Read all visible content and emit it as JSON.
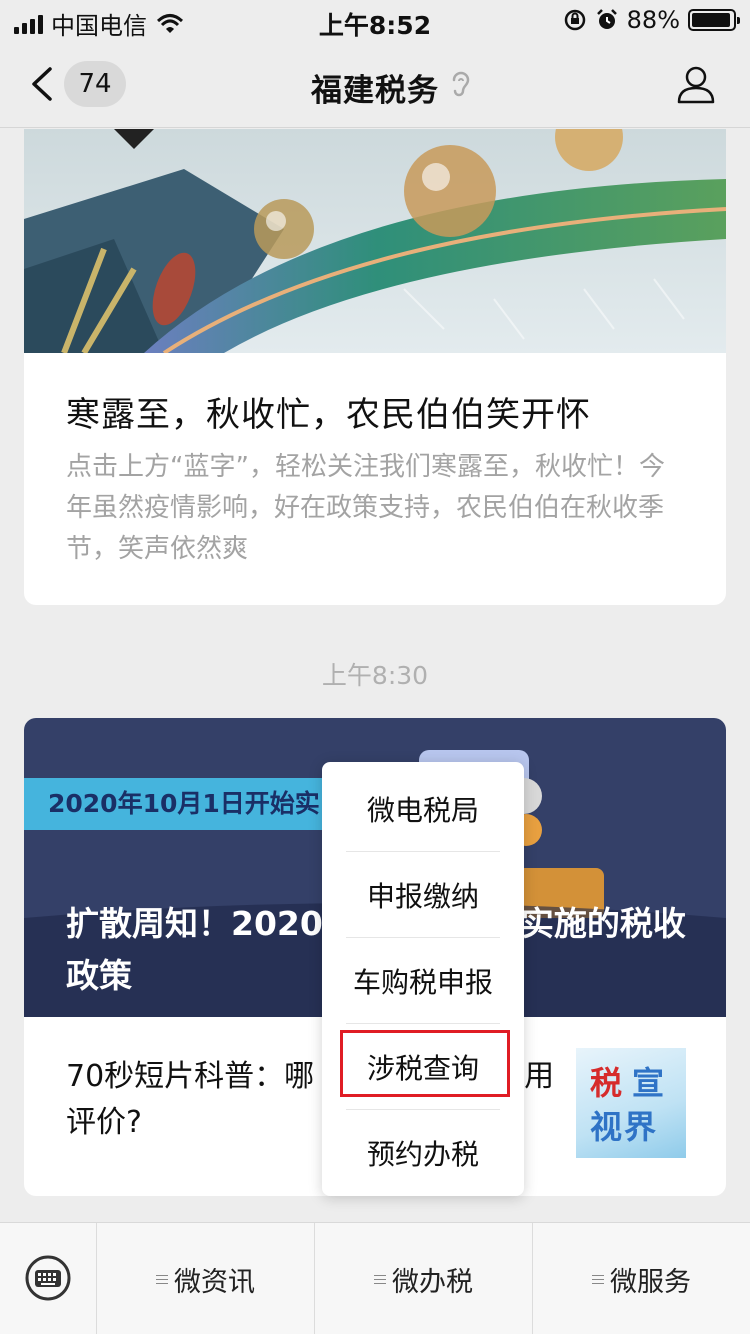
{
  "status_bar": {
    "carrier": "中国电信",
    "time": "上午8:52",
    "battery": "88%"
  },
  "nav": {
    "back_count": "74",
    "title": "福建税务"
  },
  "articles": [
    {
      "title": "寒露至，秋收忙，农民伯伯笑开怀",
      "desc": "点击上方“蓝字”，轻松关注我们寒露至，秋收忙！今年虽然疫情影响，好在政策支持，农民伯伯在秋收季节，笑声依然爽"
    }
  ],
  "timestamp": "上午8:30",
  "article_group": {
    "hero_banner_text": "2020年10月1日开始实",
    "hero_title": "扩散周知！2020年10月1日开始实施的税收政策",
    "hero_title_visible": "扩散周知！2020　　　　开始实施的税收政策",
    "sub_title": "70秒短片科普：哪些与纳税信用评价?",
    "sub_title_visible": "70秒短片科普：哪　　　与纳税信用评价?",
    "thumb_text": [
      "税",
      "宣",
      "视界"
    ]
  },
  "popup_menu": {
    "items": [
      "微电税局",
      "申报缴纳",
      "车购税申报",
      "涉税查询",
      "预约办税"
    ],
    "highlighted_index": 3,
    "highlight_color": "#e01c24"
  },
  "bottom_menu": {
    "tabs": [
      "微资讯",
      "微办税",
      "微服务"
    ]
  }
}
